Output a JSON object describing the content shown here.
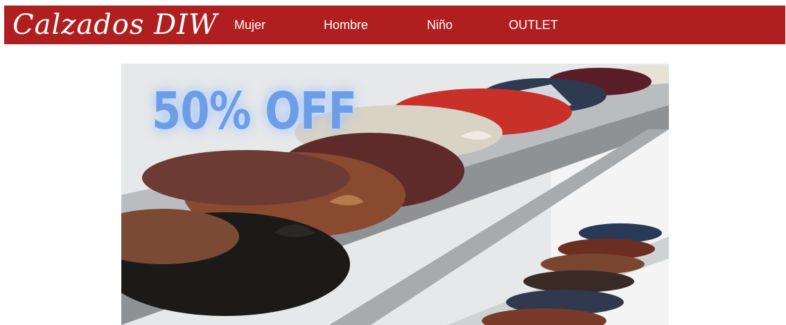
{
  "header": {
    "brand": "Calzados DIW",
    "nav": [
      {
        "label": "Mujer"
      },
      {
        "label": "Hombre"
      },
      {
        "label": "Niño"
      },
      {
        "label": "OUTLET"
      }
    ]
  },
  "hero": {
    "promo_text": "50% OFF"
  },
  "colors": {
    "navbar_bg": "#b01f1f",
    "nav_text": "#ffffff",
    "promo_text": "#6d9de6"
  }
}
